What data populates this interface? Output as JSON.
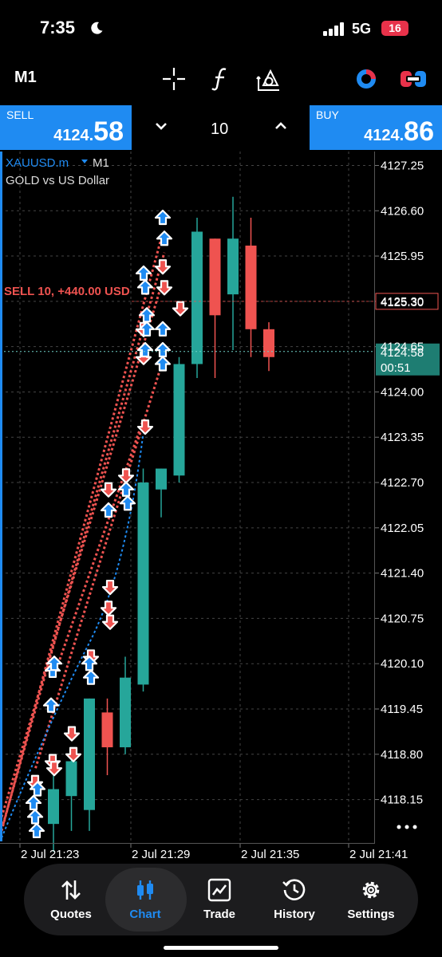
{
  "status": {
    "time": "7:35",
    "network": "5G",
    "battery": "16"
  },
  "toolbar": {
    "timeframe": "M1"
  },
  "trade": {
    "sell_label": "SELL",
    "sell_small": "4124.",
    "sell_big": "58",
    "buy_label": "BUY",
    "buy_small": "4124.",
    "buy_big": "86",
    "quantity": "10"
  },
  "symbol": {
    "ticker": "XAUUSD.m",
    "timeframe": "M1",
    "description": "GOLD vs US Dollar"
  },
  "position": {
    "label": "SELL 10, +440.00 USD",
    "price": "4125.30"
  },
  "current": {
    "price": "4124.58",
    "countdown": "00:51"
  },
  "colors": {
    "bull": "#26a69a",
    "bear": "#ef5350",
    "accent": "#1f8bf2",
    "position": "#ef5350"
  },
  "chart_data": {
    "type": "candlestick",
    "symbol": "XAUUSD.m",
    "timeframe": "M1",
    "y_ticks": [
      "4127.25",
      "4126.60",
      "4125.95",
      "4125.30",
      "4124.65",
      "4124.00",
      "4123.35",
      "4122.70",
      "4122.05",
      "4121.40",
      "4120.75",
      "4120.10",
      "4119.45",
      "4118.80",
      "4118.15"
    ],
    "ylim": [
      4117.55,
      4127.45
    ],
    "x_ticks": [
      "2 Jul 21:23",
      "2 Jul 21:29",
      "2 Jul 21:35",
      "2 Jul 21:41"
    ],
    "candles": [
      {
        "o": 4117.8,
        "h": 4118.5,
        "l": 4117.4,
        "c": 4118.3
      },
      {
        "o": 4118.2,
        "h": 4118.9,
        "l": 4117.7,
        "c": 4118.7
      },
      {
        "o": 4118.0,
        "h": 4119.6,
        "l": 4117.7,
        "c": 4119.6
      },
      {
        "o": 4119.4,
        "h": 4119.6,
        "l": 4118.5,
        "c": 4118.9
      },
      {
        "o": 4118.9,
        "h": 4120.2,
        "l": 4118.8,
        "c": 4119.9
      },
      {
        "o": 4119.8,
        "h": 4122.9,
        "l": 4119.7,
        "c": 4122.7
      },
      {
        "o": 4122.6,
        "h": 4122.9,
        "l": 4122.2,
        "c": 4122.9
      },
      {
        "o": 4122.8,
        "h": 4124.5,
        "l": 4122.7,
        "c": 4124.4
      },
      {
        "o": 4124.4,
        "h": 4126.5,
        "l": 4124.2,
        "c": 4126.3
      },
      {
        "o": 4126.2,
        "h": 4126.2,
        "l": 4124.2,
        "c": 4125.1
      },
      {
        "o": 4125.4,
        "h": 4126.8,
        "l": 4124.6,
        "c": 4126.2
      },
      {
        "o": 4126.1,
        "h": 4126.5,
        "l": 4124.5,
        "c": 4124.9
      },
      {
        "o": 4124.9,
        "h": 4125.0,
        "l": 4124.3,
        "c": 4124.5
      }
    ],
    "position_line": 4125.3,
    "bid_line": 4124.58
  }
}
